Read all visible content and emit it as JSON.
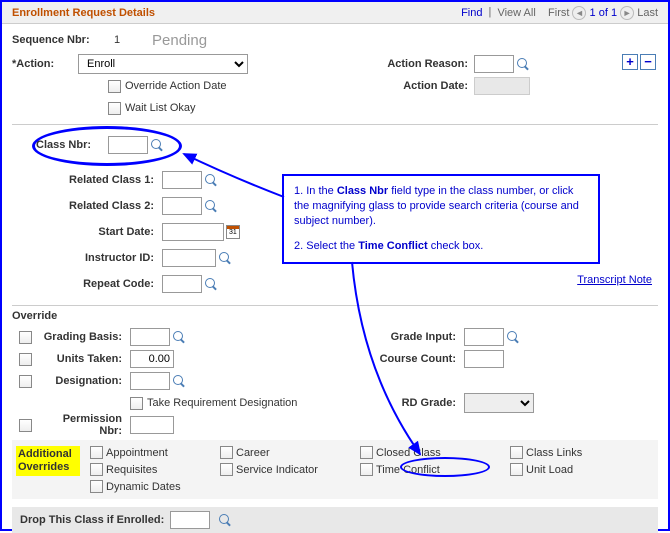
{
  "header": {
    "title": "Enrollment Request Details",
    "nav": {
      "find": "Find",
      "viewAll": "View All",
      "first": "First",
      "position": "1 of 1",
      "last": "Last"
    }
  },
  "top": {
    "seqLabel": "Sequence Nbr:",
    "seqValue": "1",
    "statusText": "Pending",
    "actionLabel": "*Action:",
    "actionValue": "Enroll",
    "actionReasonLabel": "Action Reason:",
    "actionDateLabel": "Action Date:",
    "overrideActionDate": "Override Action Date",
    "waitListOkay": "Wait List Okay",
    "plus": "+",
    "minus": "−"
  },
  "classNbr": {
    "label": "Class Nbr:"
  },
  "related": {
    "class1": "Related Class 1:",
    "class2": "Related Class 2:",
    "startDate": "Start Date:",
    "instructorId": "Instructor ID:",
    "repeatCode": "Repeat Code:"
  },
  "transcriptNote": "Transcript Note",
  "overrideSection": {
    "title": "Override",
    "gradingBasis": "Grading Basis:",
    "unitsTaken": "Units Taken:",
    "unitsTakenValue": "0.00",
    "designation": "Designation:",
    "takeReqDes": "Take Requirement Designation",
    "permissionNbr": "Permission Nbr:",
    "gradeInput": "Grade Input:",
    "courseCount": "Course Count:",
    "rdGrade": "RD Grade:"
  },
  "additionalOverrides": {
    "label": "Additional Overrides",
    "items": {
      "appointment": "Appointment",
      "career": "Career",
      "closedClass": "Closed Class",
      "classLinks": "Class Links",
      "requisites": "Requisites",
      "serviceIndicator": "Service Indicator",
      "timeConflict": "Time Conflict",
      "unitLoad": "Unit Load",
      "dynamicDates": "Dynamic Dates"
    }
  },
  "dropRow": {
    "label": "Drop This Class if Enrolled:"
  },
  "callout": {
    "line1a": "1. In the ",
    "line1b": "Class Nbr",
    "line1c": " field type in the class number, or click the magnifying glass to provide search criteria (course and subject number).",
    "line2a": "2. Select the ",
    "line2b": "Time Conflict",
    "line2c": " check box."
  }
}
